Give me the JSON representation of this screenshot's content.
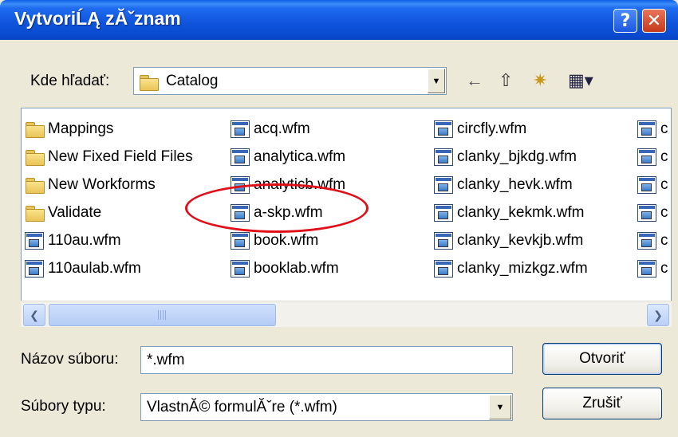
{
  "window": {
    "title": "VytvoriĹĄ zĂˇznam",
    "help_glyph": "?",
    "close_glyph": "✕"
  },
  "lookin": {
    "label": "Kde hľadať:",
    "value": "Catalog"
  },
  "toolbar": {
    "back": "←",
    "up": "⇧",
    "new_folder": "✷",
    "views": "▦▾"
  },
  "files": {
    "columns": [
      [
        {
          "name": "Mappings",
          "kind": "folder"
        },
        {
          "name": "New Fixed Field Files",
          "kind": "folder"
        },
        {
          "name": "New Workforms",
          "kind": "folder"
        },
        {
          "name": "Validate",
          "kind": "folder"
        },
        {
          "name": "110au.wfm",
          "kind": "form"
        },
        {
          "name": "110aulab.wfm",
          "kind": "form"
        }
      ],
      [
        {
          "name": "acq.wfm",
          "kind": "form"
        },
        {
          "name": "analytica.wfm",
          "kind": "form"
        },
        {
          "name": "analyticb.wfm",
          "kind": "form"
        },
        {
          "name": "a-skp.wfm",
          "kind": "form"
        },
        {
          "name": "book.wfm",
          "kind": "form"
        },
        {
          "name": "booklab.wfm",
          "kind": "form"
        }
      ],
      [
        {
          "name": "circfly.wfm",
          "kind": "form"
        },
        {
          "name": "clanky_bjkdg.wfm",
          "kind": "form"
        },
        {
          "name": "clanky_hevk.wfm",
          "kind": "form"
        },
        {
          "name": "clanky_kekmk.wfm",
          "kind": "form"
        },
        {
          "name": "clanky_kevkjb.wfm",
          "kind": "form"
        },
        {
          "name": "clanky_mizkgz.wfm",
          "kind": "form"
        }
      ],
      [
        {
          "name": "c",
          "kind": "form"
        },
        {
          "name": "c",
          "kind": "form"
        },
        {
          "name": "c",
          "kind": "form"
        },
        {
          "name": "c",
          "kind": "form"
        },
        {
          "name": "c",
          "kind": "form"
        },
        {
          "name": "c",
          "kind": "form"
        }
      ]
    ]
  },
  "scrollbar": {
    "left_arrow": "❮",
    "right_arrow": "❯"
  },
  "filename": {
    "label": "Názov súboru:",
    "value": "*.wfm"
  },
  "filetype": {
    "label": "Súbory typu:",
    "value": "VlastnĂ© formulĂˇre (*.wfm)"
  },
  "buttons": {
    "open": "Otvoriť",
    "cancel": "Zrušiť"
  },
  "colors": {
    "annotation": "#E0101A",
    "title_bar": "#0F55DD"
  }
}
